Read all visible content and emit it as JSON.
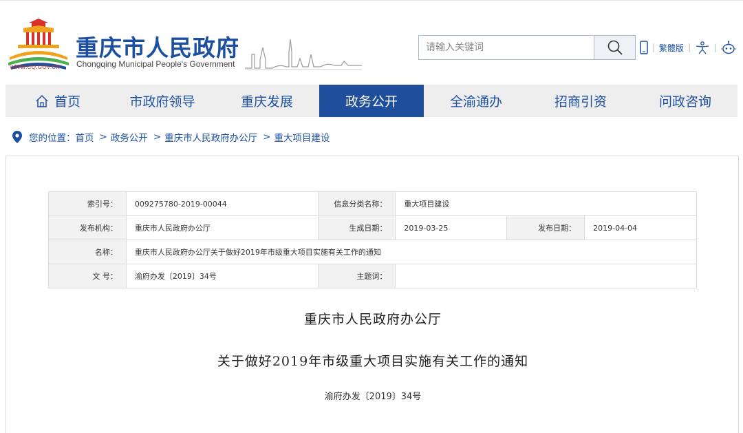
{
  "header": {
    "title_cn": "重庆市人民政府",
    "title_en": "Chongqing Municipal People's Government",
    "logo_url_text": "WWW.CQ.GOV.CN",
    "logo_colors": {
      "red": "#d9302c",
      "orange": "#f0a21c",
      "blue": "#1d4fa0",
      "green": "#4caf50"
    },
    "search": {
      "placeholder": "请输入关键词",
      "button_icon": "search-icon"
    },
    "tools": {
      "mobile_icon": "mobile-icon",
      "traditional_label": "繁體版",
      "accessibility_icon": "accessibility-icon",
      "robot_icon": "robot-icon"
    }
  },
  "nav": {
    "items": [
      {
        "label": "首页",
        "icon": "home-icon",
        "active": false
      },
      {
        "label": "市政府领导",
        "active": false
      },
      {
        "label": "重庆发展",
        "active": false
      },
      {
        "label": "政务公开",
        "active": true
      },
      {
        "label": "全渝通办",
        "active": false
      },
      {
        "label": "招商引资",
        "active": false
      },
      {
        "label": "问政咨询",
        "active": false
      }
    ],
    "active_color": "#1f4e9c"
  },
  "breadcrumb": {
    "prefix": "您的位置：",
    "items": [
      "首页",
      "政务公开",
      "重庆市人民政府办公厅",
      "重大项目建设"
    ],
    "separator": ">"
  },
  "meta": {
    "index_label": "索引号：",
    "index_value": "009275780-2019-00044",
    "category_label": "信息分类名称：",
    "category_value": "重大项目建设",
    "publisher_label": "发布机构：",
    "publisher_value": "重庆市人民政府办公厅",
    "created_label": "生成日期：",
    "created_value": "2019-03-25",
    "published_label": "发布日期：",
    "published_value": "2019-04-04",
    "name_label": "名称：",
    "name_value": "重庆市人民政府办公厅关于做好2019年市级重大项目实施有关工作的通知",
    "docno_label": "文 号：",
    "docno_value": "渝府办发〔2019〕34号",
    "keywords_label": "主题词：",
    "keywords_value": ""
  },
  "document": {
    "issuer": "重庆市人民政府办公厅",
    "title": "关于做好2019年市级重大项目实施有关工作的通知",
    "number": "渝府办发〔2019〕34号"
  }
}
